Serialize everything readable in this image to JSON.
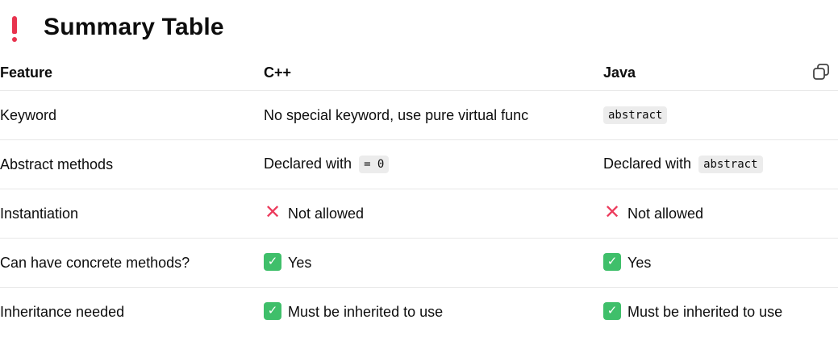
{
  "heading": {
    "icon": "exclamation-icon",
    "title": "Summary Table"
  },
  "table": {
    "headers": [
      "Feature",
      "C++",
      "Java"
    ],
    "rows": [
      {
        "feature": "Keyword",
        "cpp_text": "No special keyword, use pure virtual func",
        "java_code": "abstract"
      },
      {
        "feature": "Abstract methods",
        "cpp_text": "Declared with",
        "cpp_code": "= 0",
        "java_text": "Declared with",
        "java_code": "abstract"
      },
      {
        "feature": "Instantiation",
        "cpp_icon": "cross-mark-icon",
        "cpp_text": "Not allowed",
        "java_icon": "cross-mark-icon",
        "java_text": "Not allowed"
      },
      {
        "feature": "Can have concrete methods?",
        "cpp_icon": "check-mark-icon",
        "cpp_text": "Yes",
        "java_icon": "check-mark-icon",
        "java_text": "Yes"
      },
      {
        "feature": "Inheritance needed",
        "cpp_icon": "check-mark-icon",
        "cpp_text": "Must be inherited to use",
        "java_icon": "check-mark-icon",
        "java_text": "Must be inherited to use"
      }
    ]
  },
  "colors": {
    "heading_icon": "#e8334e",
    "check": "#3fbf6a",
    "cross": "#ec3b5c",
    "code_bg": "#ececec",
    "divider": "#e7e7e7"
  }
}
